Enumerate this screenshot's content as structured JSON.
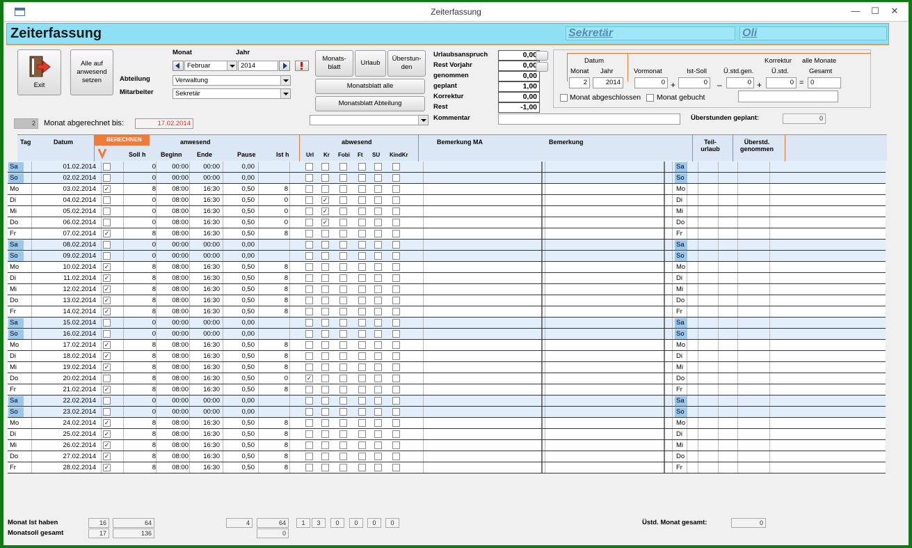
{
  "window": {
    "title": "Zeiterfassung"
  },
  "header": {
    "title": "Zeiterfassung",
    "abteilung": "Sekretär",
    "mitarbeiter": "Oli"
  },
  "toolbar": {
    "exit_label": "Exit",
    "alle_anwesend_label": "Alle auf anwesend setzen"
  },
  "selectors": {
    "monat_label": "Monat",
    "jahr_label": "Jahr",
    "monat_value": "Februar",
    "jahr_value": "2014",
    "abteilung_label": "Abteilung",
    "abteilung_value": "Verwaltung",
    "mitarbeiter_label": "Mitarbeiter",
    "mitarbeiter_value": "Sekretär"
  },
  "buttons": {
    "monatsblatt": "Monats-blatt",
    "urlaub": "Urlaub",
    "ueberstunden": "Überstun-den",
    "monatsblatt_alle": "Monatsblatt alle",
    "monatsblatt_abteilung": "Monatsblatt Abteilung"
  },
  "urlaub": {
    "items": [
      {
        "label": "Urlaubsanspruch",
        "value": "0,00"
      },
      {
        "label": "Rest Vorjahr",
        "value": "0,00"
      },
      {
        "label": "genommen",
        "value": "0,00"
      },
      {
        "label": "geplant",
        "value": "1,00"
      },
      {
        "label": "Korrektur",
        "value": "0,00"
      },
      {
        "label": "Rest",
        "value": "-1,00"
      }
    ],
    "kommentar_label": "Kommentar"
  },
  "korrektur": {
    "datum_label": "Datum",
    "monat_label": "Monat",
    "jahr_label": "Jahr",
    "monat": "2",
    "jahr": "2014",
    "title": "Korrektur",
    "alle_monate": "alle Monate",
    "vormonat_label": "Vormonat",
    "istsoll_label": "Ist-Soll",
    "ustdgen_label": "Ü.std.gen.",
    "ustd_label": "Ü.std.",
    "gesamt_label": "Gesamt",
    "vormonat": "0",
    "istsoll": "0",
    "ustdgen": "0",
    "ustd": "0",
    "gesamt": "0",
    "plus1": "+",
    "minus": "–",
    "plus2": "+",
    "eq": "=",
    "abgeschlossen_label": "Monat abgeschlossen",
    "gebucht_label": "Monat gebucht",
    "geplant_label": "Überstunden geplant:",
    "geplant_value": "0"
  },
  "abgerechnet": {
    "count": "2",
    "label": "Monat abgerechnet bis:",
    "date": "17.02.2014"
  },
  "columns": {
    "tag": "Tag",
    "datum": "Datum",
    "berechnen": "BERECHNEN",
    "anwesend": "anwesend",
    "sollh": "Soll h",
    "beginn": "Beginn",
    "ende": "Ende",
    "pause": "Pause",
    "isth": "Ist h",
    "abwesend": "abwesend",
    "url": "Url",
    "kr": "Kr",
    "fobi": "Fobi",
    "ft": "Ft",
    "su": "SU",
    "kindkr": "KindKr",
    "bemerkungma": "Bemerkung MA",
    "bemerkung": "Bemerkung",
    "teilurlaub": "Teil-urlaub",
    "ueberstd": "Überstd. genommen"
  },
  "rows": [
    {
      "tag": "Sa",
      "datum": "01.02.2014",
      "calc": false,
      "soll": "0",
      "beginn": "00:00",
      "ende": "00:00",
      "pause": "0,00",
      "ist": "",
      "url": false,
      "kr": false,
      "we": true
    },
    {
      "tag": "So",
      "datum": "02.02.2014",
      "calc": false,
      "soll": "0",
      "beginn": "00:00",
      "ende": "00:00",
      "pause": "0,00",
      "ist": "",
      "url": false,
      "kr": false,
      "we": true
    },
    {
      "tag": "Mo",
      "datum": "03.02.2014",
      "calc": true,
      "soll": "8",
      "beginn": "08:00",
      "ende": "16:30",
      "pause": "0,50",
      "ist": "8",
      "url": false,
      "kr": false,
      "we": false
    },
    {
      "tag": "Di",
      "datum": "04.02.2014",
      "calc": false,
      "soll": "0",
      "beginn": "08:00",
      "ende": "16:30",
      "pause": "0,50",
      "ist": "0",
      "url": false,
      "kr": true,
      "we": false
    },
    {
      "tag": "Mi",
      "datum": "05.02.2014",
      "calc": false,
      "soll": "0",
      "beginn": "08:00",
      "ende": "16:30",
      "pause": "0,50",
      "ist": "0",
      "url": false,
      "kr": true,
      "we": false
    },
    {
      "tag": "Do",
      "datum": "06.02.2014",
      "calc": false,
      "soll": "0",
      "beginn": "08:00",
      "ende": "16:30",
      "pause": "0,50",
      "ist": "0",
      "url": false,
      "kr": true,
      "we": false
    },
    {
      "tag": "Fr",
      "datum": "07.02.2014",
      "calc": true,
      "soll": "8",
      "beginn": "08:00",
      "ende": "16:30",
      "pause": "0,50",
      "ist": "8",
      "url": false,
      "kr": false,
      "we": false
    },
    {
      "tag": "Sa",
      "datum": "08.02.2014",
      "calc": false,
      "soll": "0",
      "beginn": "00:00",
      "ende": "00:00",
      "pause": "0,00",
      "ist": "",
      "url": false,
      "kr": false,
      "we": true
    },
    {
      "tag": "So",
      "datum": "09.02.2014",
      "calc": false,
      "soll": "0",
      "beginn": "00:00",
      "ende": "00:00",
      "pause": "0,00",
      "ist": "",
      "url": false,
      "kr": false,
      "we": true
    },
    {
      "tag": "Mo",
      "datum": "10.02.2014",
      "calc": true,
      "soll": "8",
      "beginn": "08:00",
      "ende": "16:30",
      "pause": "0,50",
      "ist": "8",
      "url": false,
      "kr": false,
      "we": false
    },
    {
      "tag": "Di",
      "datum": "11.02.2014",
      "calc": true,
      "soll": "8",
      "beginn": "08:00",
      "ende": "16:30",
      "pause": "0,50",
      "ist": "8",
      "url": false,
      "kr": false,
      "we": false
    },
    {
      "tag": "Mi",
      "datum": "12.02.2014",
      "calc": true,
      "soll": "8",
      "beginn": "08:00",
      "ende": "16:30",
      "pause": "0,50",
      "ist": "8",
      "url": false,
      "kr": false,
      "we": false
    },
    {
      "tag": "Do",
      "datum": "13.02.2014",
      "calc": true,
      "soll": "8",
      "beginn": "08:00",
      "ende": "16:30",
      "pause": "0,50",
      "ist": "8",
      "url": false,
      "kr": false,
      "we": false
    },
    {
      "tag": "Fr",
      "datum": "14.02.2014",
      "calc": true,
      "soll": "8",
      "beginn": "08:00",
      "ende": "16:30",
      "pause": "0,50",
      "ist": "8",
      "url": false,
      "kr": false,
      "we": false
    },
    {
      "tag": "Sa",
      "datum": "15.02.2014",
      "calc": false,
      "soll": "0",
      "beginn": "00:00",
      "ende": "00:00",
      "pause": "0,00",
      "ist": "",
      "url": false,
      "kr": false,
      "we": true
    },
    {
      "tag": "So",
      "datum": "16.02.2014",
      "calc": false,
      "soll": "0",
      "beginn": "00:00",
      "ende": "00:00",
      "pause": "0,00",
      "ist": "",
      "url": false,
      "kr": false,
      "we": true
    },
    {
      "tag": "Mo",
      "datum": "17.02.2014",
      "calc": true,
      "soll": "8",
      "beginn": "08:00",
      "ende": "16:30",
      "pause": "0,50",
      "ist": "8",
      "url": false,
      "kr": false,
      "we": false
    },
    {
      "tag": "Di",
      "datum": "18.02.2014",
      "calc": true,
      "soll": "8",
      "beginn": "08:00",
      "ende": "16:30",
      "pause": "0,50",
      "ist": "8",
      "url": false,
      "kr": false,
      "we": false
    },
    {
      "tag": "Mi",
      "datum": "19.02.2014",
      "calc": true,
      "soll": "8",
      "beginn": "08:00",
      "ende": "16:30",
      "pause": "0,50",
      "ist": "8",
      "url": false,
      "kr": false,
      "we": false
    },
    {
      "tag": "Do",
      "datum": "20.02.2014",
      "calc": false,
      "soll": "8",
      "beginn": "08:00",
      "ende": "16:30",
      "pause": "0,50",
      "ist": "0",
      "url": true,
      "kr": false,
      "we": false
    },
    {
      "tag": "Fr",
      "datum": "21.02.2014",
      "calc": true,
      "soll": "8",
      "beginn": "08:00",
      "ende": "16:30",
      "pause": "0,50",
      "ist": "8",
      "url": false,
      "kr": false,
      "we": false
    },
    {
      "tag": "Sa",
      "datum": "22.02.2014",
      "calc": false,
      "soll": "0",
      "beginn": "00:00",
      "ende": "00:00",
      "pause": "0,00",
      "ist": "",
      "url": false,
      "kr": false,
      "we": true
    },
    {
      "tag": "So",
      "datum": "23.02.2014",
      "calc": false,
      "soll": "0",
      "beginn": "00:00",
      "ende": "00:00",
      "pause": "0,00",
      "ist": "",
      "url": false,
      "kr": false,
      "we": true
    },
    {
      "tag": "Mo",
      "datum": "24.02.2014",
      "calc": true,
      "soll": "8",
      "beginn": "08:00",
      "ende": "16:30",
      "pause": "0,50",
      "ist": "8",
      "url": false,
      "kr": false,
      "we": false
    },
    {
      "tag": "Di",
      "datum": "25.02.2014",
      "calc": true,
      "soll": "8",
      "beginn": "08:00",
      "ende": "16:30",
      "pause": "0,50",
      "ist": "8",
      "url": false,
      "kr": false,
      "we": false
    },
    {
      "tag": "Mi",
      "datum": "26.02.2014",
      "calc": true,
      "soll": "8",
      "beginn": "08:00",
      "ende": "16:30",
      "pause": "0,50",
      "ist": "8",
      "url": false,
      "kr": false,
      "we": false
    },
    {
      "tag": "Do",
      "datum": "27.02.2014",
      "calc": true,
      "soll": "8",
      "beginn": "08:00",
      "ende": "16:30",
      "pause": "0,50",
      "ist": "8",
      "url": false,
      "kr": false,
      "we": false
    },
    {
      "tag": "Fr",
      "datum": "28.02.2014",
      "calc": true,
      "soll": "8",
      "beginn": "08:00",
      "ende": "16:30",
      "pause": "0,50",
      "ist": "8",
      "url": false,
      "kr": false,
      "we": false
    }
  ],
  "totals": {
    "ist_label": "Monat Ist haben",
    "soll_label": "Monatsoll gesamt",
    "ist_days": "16",
    "ist_hours": "64",
    "soll_days": "17",
    "soll_hours": "136",
    "pause": "4",
    "isth": "64",
    "isth2": "0",
    "abw": [
      "1",
      "3",
      "0",
      "0",
      "0",
      "0"
    ],
    "ustd_label": "Üstd. Monat gesamt:",
    "ustd_value": "0"
  },
  "colors": {
    "header_bg": "#8fe0f5",
    "accent_orange": "#e07a3a",
    "weekend_blue": "#9cc7ec"
  }
}
